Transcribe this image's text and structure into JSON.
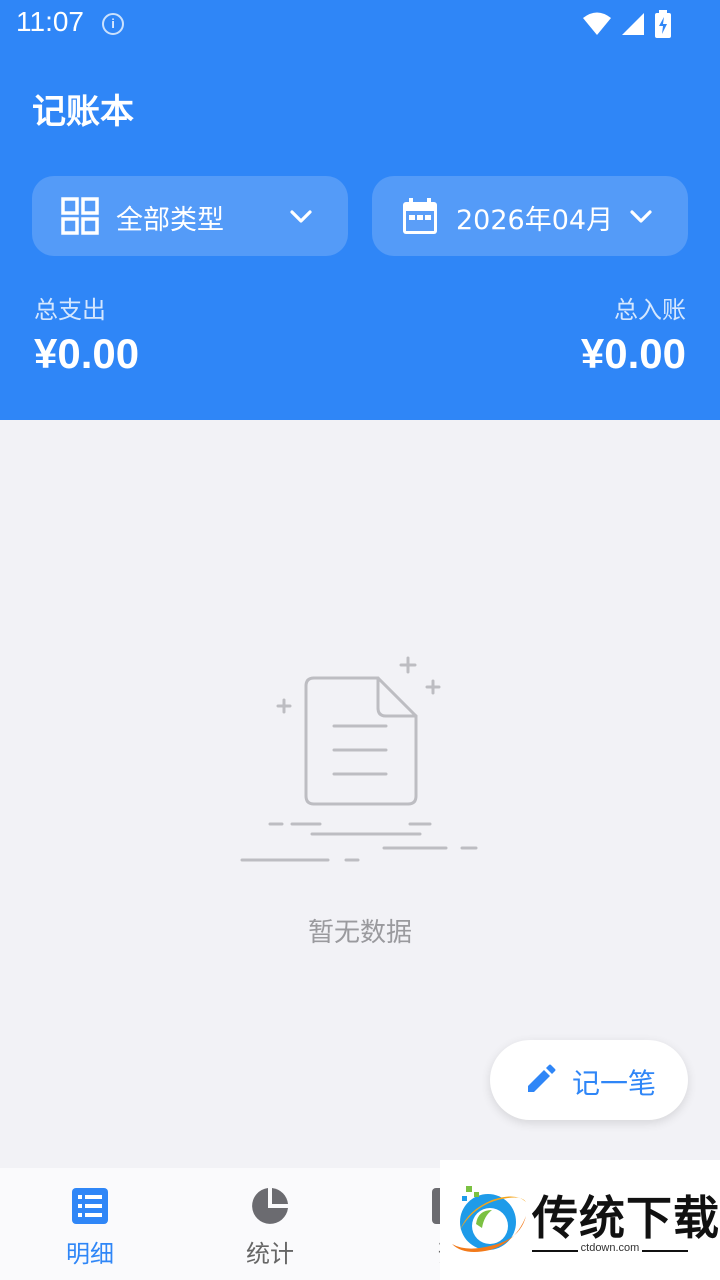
{
  "status_bar": {
    "time": "11:07",
    "info_glyph": "i"
  },
  "app": {
    "title": "记账本"
  },
  "filters": {
    "type_label": "全部类型",
    "date_label": "2026年04月"
  },
  "summary": {
    "expense_label": "总支出",
    "expense_value": "¥0.00",
    "income_label": "总入账",
    "income_value": "¥0.00"
  },
  "empty_state": {
    "message": "暂无数据"
  },
  "fab": {
    "label": "记一笔"
  },
  "tabs": [
    {
      "label": "明细",
      "active": true
    },
    {
      "label": "统计",
      "active": false
    },
    {
      "label": "预",
      "active": false
    }
  ],
  "watermark": {
    "brand": "传统下载",
    "url": "ctdown.com"
  },
  "colors": {
    "primary": "#2f86f7",
    "background": "#f2f2f6",
    "muted": "#9a9a9e"
  }
}
